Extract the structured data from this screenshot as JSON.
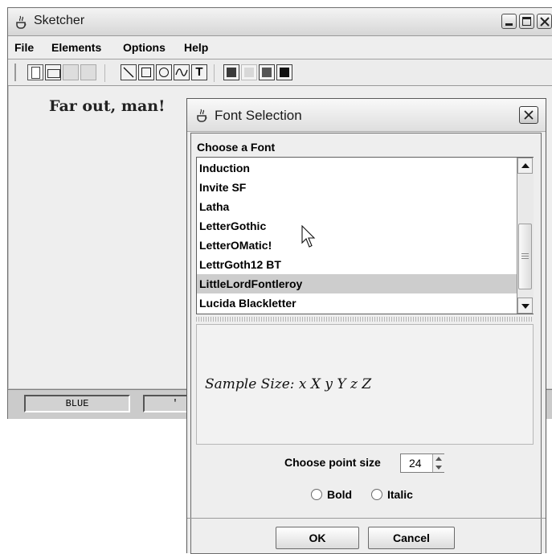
{
  "main_window": {
    "title": "Sketcher",
    "menus": [
      "File",
      "Elements",
      "Options",
      "Help"
    ],
    "canvas_text": "Far out, man!",
    "status": [
      "BLUE",
      "'"
    ],
    "icons": {
      "app": "java-cup-icon",
      "toolbar": [
        "new-file-icon",
        "open-icon",
        "save-icon",
        "print-icon",
        "line-tool-icon",
        "rectangle-tool-icon",
        "circle-tool-icon",
        "curve-tool-icon",
        "text-tool-icon"
      ],
      "swatches": [
        "#3a3a3a",
        "#d8d8d8",
        "#555555",
        "#111111"
      ]
    }
  },
  "dialog": {
    "title": "Font Selection",
    "choose_label": "Choose a Font",
    "fonts": [
      "Induction",
      "Invite SF",
      "Latha",
      "LetterGothic",
      "LetterOMatic!",
      "LettrGoth12 BT",
      "LittleLordFontleroy",
      "Lucida Blackletter"
    ],
    "selected_font": "LittleLordFontleroy",
    "sample_text": "Sample Size: x X y Y z Z",
    "point_size_label": "Choose point size",
    "point_size": "24",
    "bold_label": "Bold",
    "italic_label": "Italic",
    "ok_label": "OK",
    "cancel_label": "Cancel"
  }
}
